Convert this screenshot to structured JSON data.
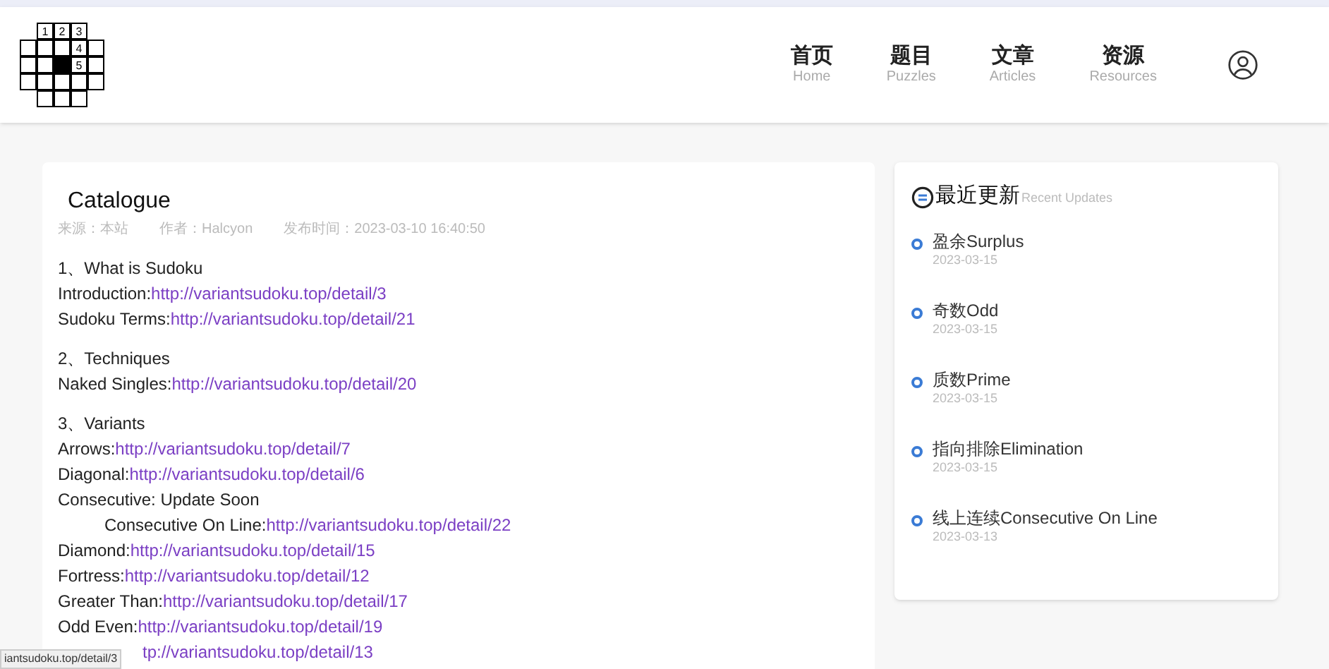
{
  "logo": {
    "digits": [
      "1",
      "2",
      "3",
      "4",
      "5"
    ]
  },
  "nav": [
    {
      "label": "首页",
      "sub": "Home"
    },
    {
      "label": "题目",
      "sub": "Puzzles"
    },
    {
      "label": "文章",
      "sub": "Articles"
    },
    {
      "label": "资源",
      "sub": "Resources"
    }
  ],
  "article": {
    "title": "Catalogue",
    "meta": [
      "来源：本站",
      "作者：Halcyon",
      "发布时间：2023-03-10 16:40:50"
    ],
    "sections": [
      {
        "heading": "1、What is Sudoku",
        "rows": [
          {
            "label": "Introduction:",
            "link": "http://variantsudoku.top/detail/3",
            "indented": false
          },
          {
            "label": "Sudoku Terms:",
            "link": "http://variantsudoku.top/detail/21",
            "indented": false
          }
        ]
      },
      {
        "heading": "2、Techniques",
        "rows": [
          {
            "label": "Naked Singles:",
            "link": "http://variantsudoku.top/detail/20",
            "indented": false
          }
        ]
      },
      {
        "heading": "3、Variants",
        "rows": [
          {
            "label": "Arrows:",
            "link": "http://variantsudoku.top/detail/7",
            "indented": false
          },
          {
            "label": "Diagonal:",
            "link": "http://variantsudoku.top/detail/6",
            "indented": false
          },
          {
            "label": "Consecutive: Update Soon",
            "indented": false
          },
          {
            "label": "Consecutive On Line:",
            "link": "http://variantsudoku.top/detail/22",
            "indented": true
          },
          {
            "label": "Diamond:",
            "link": "http://variantsudoku.top/detail/15",
            "indented": false
          },
          {
            "label": "Fortress:",
            "link": "http://variantsudoku.top/detail/12",
            "indented": false
          },
          {
            "label": "Greater Than:",
            "link": "http://variantsudoku.top/detail/17",
            "indented": false
          },
          {
            "label": "Odd Even:",
            "link": "http://variantsudoku.top/detail/19",
            "indented": false
          },
          {
            "link": "tp://variantsudoku.top/detail/13",
            "indented": false
          }
        ]
      }
    ]
  },
  "recent": {
    "title": "最近更新",
    "subtitle": "Recent Updates",
    "items": [
      {
        "title": "盈余Surplus",
        "date": "2023-03-15"
      },
      {
        "title": "奇数Odd",
        "date": "2023-03-15"
      },
      {
        "title": "质数Prime",
        "date": "2023-03-15"
      },
      {
        "title": "指向排除Elimination",
        "date": "2023-03-15"
      },
      {
        "title": "线上连续Consecutive On Line",
        "date": "2023-03-13"
      }
    ]
  },
  "status_url": "iantsudoku.top/detail/3"
}
